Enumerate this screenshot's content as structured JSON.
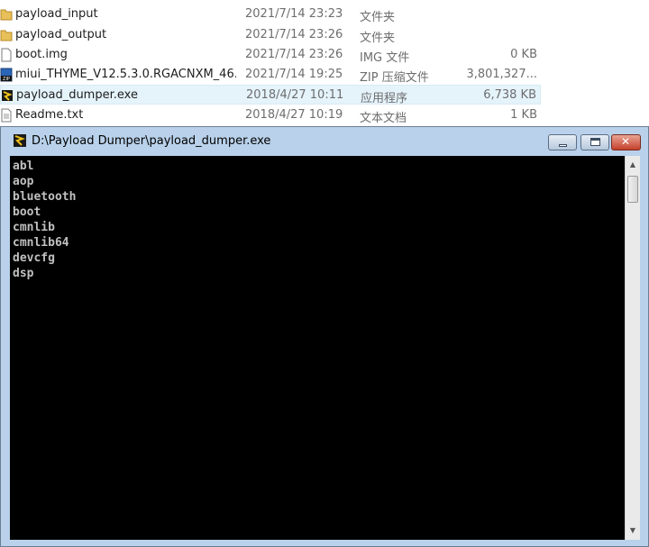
{
  "explorer": {
    "files": [
      {
        "name": "payload_input",
        "date": "2021/7/14 23:23",
        "type": "文件夹",
        "size": "",
        "icon": "folder-icon"
      },
      {
        "name": "payload_output",
        "date": "2021/7/14 23:26",
        "type": "文件夹",
        "size": "",
        "icon": "folder-icon"
      },
      {
        "name": "boot.img",
        "date": "2021/7/14 23:26",
        "type": "IMG 文件",
        "size": "0 KB",
        "icon": "file-icon"
      },
      {
        "name": "miui_THYME_V12.5.3.0.RGACNXM_46...",
        "date": "2021/7/14 19:25",
        "type": "ZIP 压缩文件",
        "size": "3,801,327...",
        "icon": "zip-icon"
      },
      {
        "name": "payload_dumper.exe",
        "date": "2018/4/27 10:11",
        "type": "应用程序",
        "size": "6,738 KB",
        "icon": "exe-icon"
      },
      {
        "name": "Readme.txt",
        "date": "2018/4/27 10:19",
        "type": "文本文档",
        "size": "1 KB",
        "icon": "text-file-icon"
      }
    ]
  },
  "console": {
    "title": "D:\\Payload Dumper\\payload_dumper.exe",
    "output": "abl\naop\nbluetooth\nboot\ncmnlib\ncmnlib64\ndevcfg\ndsp"
  },
  "colors": {
    "titlebar_bg": "#b9d1ea",
    "console_bg": "#000000",
    "console_text": "#c0c0c0",
    "selected_row": "#e5f3fb"
  }
}
